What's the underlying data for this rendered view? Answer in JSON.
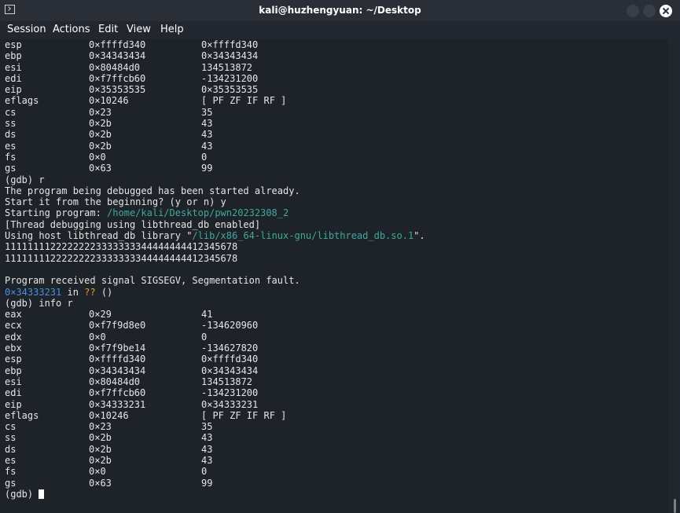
{
  "window": {
    "title": "kali@huzhengyuan: ~/Desktop"
  },
  "menu": [
    "Session",
    "Actions",
    "Edit",
    "View",
    "Help"
  ],
  "registers_top": [
    [
      "esp",
      "0×ffffd340",
      "0×ffffd340"
    ],
    [
      "ebp",
      "0×34343434",
      "0×34343434"
    ],
    [
      "esi",
      "0×80484d0",
      "134513872"
    ],
    [
      "edi",
      "0×f7ffcb60",
      "-134231200"
    ],
    [
      "eip",
      "0×35353535",
      "0×35353535"
    ],
    [
      "eflags",
      "0×10246",
      "[ PF ZF IF RF ]"
    ],
    [
      "cs",
      "0×23",
      "35"
    ],
    [
      "ss",
      "0×2b",
      "43"
    ],
    [
      "ds",
      "0×2b",
      "43"
    ],
    [
      "es",
      "0×2b",
      "43"
    ],
    [
      "fs",
      "0×0",
      "0"
    ],
    [
      "gs",
      "0×63",
      "99"
    ]
  ],
  "session": {
    "cmd_run": "(gdb) r",
    "already_started": "The program being debugged has been started already.",
    "start_question": "Start it from the beginning? (y or n) y",
    "starting_program_prefix": "Starting program: ",
    "program_path": "/home/kali/Desktop/pwn20232308_2",
    "thread_debug": "[Thread debugging using libthread_db enabled]",
    "host_lib_prefix": "Using host libthread_db library \"",
    "host_lib_path": "/lib/x86_64-linux-gnu/libthread_db.so.1",
    "host_lib_suffix": "\".",
    "output1": "11111111222222223333333344444444412345678",
    "output2": "11111111222222223333333344444444412345678",
    "signal": "Program received signal SIGSEGV, Segmentation fault.",
    "fault_addr": "0×34333231",
    "fault_in": " in ",
    "fault_func": "??",
    "fault_args": " ()",
    "cmd_info": "(gdb) info r",
    "prompt": "(gdb) "
  },
  "registers_bottom": [
    [
      "eax",
      "0×29",
      "41"
    ],
    [
      "ecx",
      "0×f7f9d8e0",
      "-134620960"
    ],
    [
      "edx",
      "0×0",
      "0"
    ],
    [
      "ebx",
      "0×f7f9be14",
      "-134627820"
    ],
    [
      "esp",
      "0×ffffd340",
      "0×ffffd340"
    ],
    [
      "ebp",
      "0×34343434",
      "0×34343434"
    ],
    [
      "esi",
      "0×80484d0",
      "134513872"
    ],
    [
      "edi",
      "0×f7ffcb60",
      "-134231200"
    ],
    [
      "eip",
      "0×34333231",
      "0×34333231"
    ],
    [
      "eflags",
      "0×10246",
      "[ PF ZF IF RF ]"
    ],
    [
      "cs",
      "0×23",
      "35"
    ],
    [
      "ss",
      "0×2b",
      "43"
    ],
    [
      "ds",
      "0×2b",
      "43"
    ],
    [
      "es",
      "0×2b",
      "43"
    ],
    [
      "fs",
      "0×0",
      "0"
    ],
    [
      "gs",
      "0×63",
      "99"
    ]
  ]
}
